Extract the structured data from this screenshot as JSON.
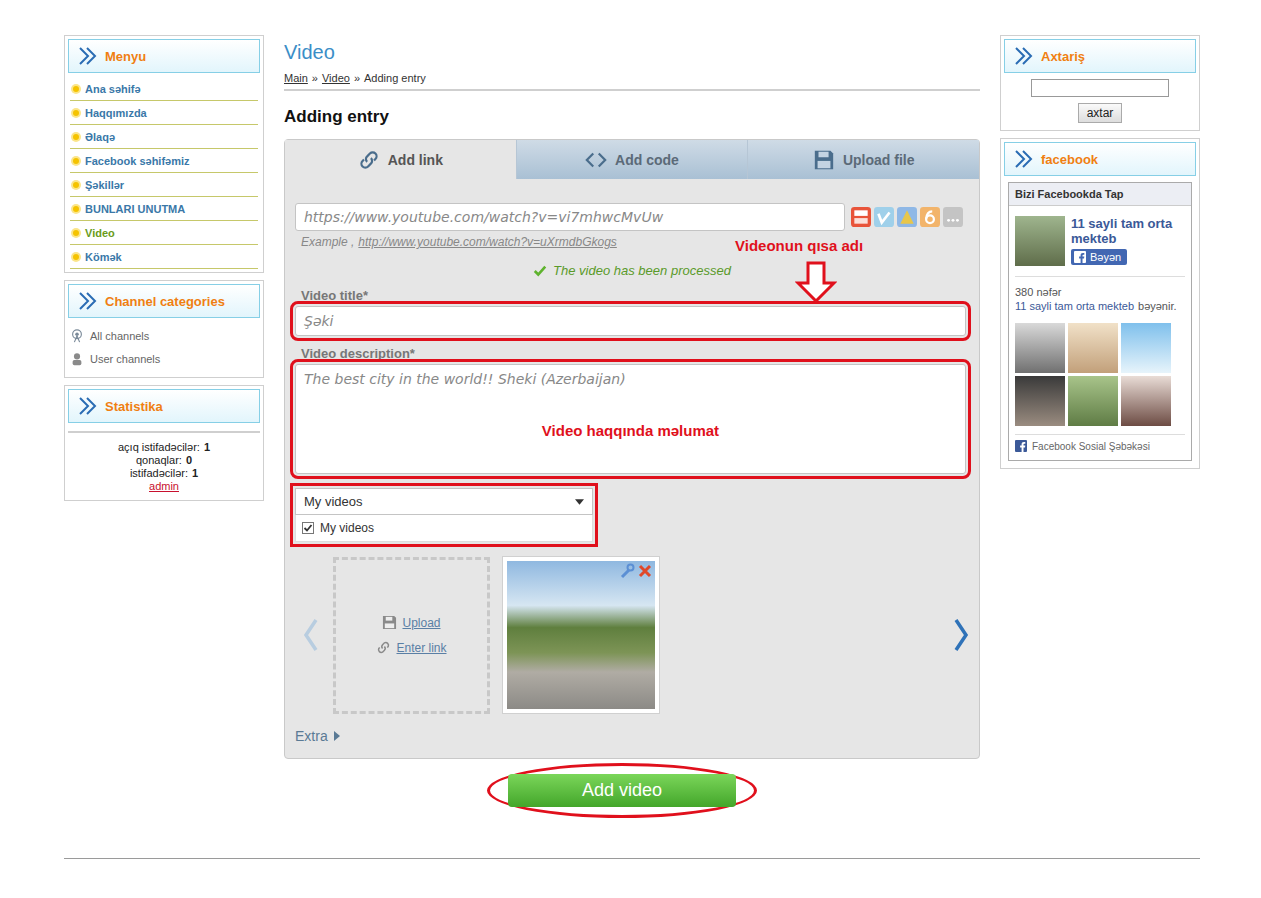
{
  "sidebar": {
    "menu": {
      "title": "Menyu",
      "items": [
        {
          "label": "Ana səhifə",
          "selected": false
        },
        {
          "label": "Haqqımızda",
          "selected": false
        },
        {
          "label": "Əlaqə",
          "selected": false
        },
        {
          "label": "Facebook səhifəmiz",
          "selected": false
        },
        {
          "label": "Şəkillər",
          "selected": false
        },
        {
          "label": "BUNLARI UNUTMA",
          "selected": false
        },
        {
          "label": "Video",
          "selected": true
        },
        {
          "label": "Kömək",
          "selected": false
        }
      ]
    },
    "categories": {
      "title": "Channel categories",
      "items": [
        {
          "label": "All channels",
          "kind": "all"
        },
        {
          "label": "User channels",
          "kind": "user"
        }
      ]
    },
    "stats": {
      "title": "Statistika",
      "lines": [
        {
          "label": "açıq istifadəcilər:",
          "value": "1"
        },
        {
          "label": "qonaqlar:",
          "value": "0"
        },
        {
          "label": "istifadəcilər:",
          "value": "1"
        }
      ],
      "user": "admin"
    }
  },
  "page": {
    "title": "Video",
    "breadcrumb": [
      {
        "label": "Main",
        "link": true
      },
      {
        "label": "Video",
        "link": true
      },
      {
        "label": "Adding entry",
        "link": false
      }
    ],
    "separator": "»",
    "heading": "Adding entry"
  },
  "tabs": [
    {
      "label": "Add link",
      "selected": true
    },
    {
      "label": "Add code",
      "selected": false
    },
    {
      "label": "Upload file",
      "selected": false
    }
  ],
  "form": {
    "url": "https://www.youtube.com/watch?v=vi7mhwcMvUw",
    "example_prefix": "Example ,",
    "example_url": "http://www.youtube.com/watch?v=uXrmdbGkogs",
    "status": "The video has been processed",
    "title_label": "Video title*",
    "title_value": "Şəki",
    "description_label": "Video description*",
    "description_value": "The best city in the world!! Sheki (Azerbaijan)",
    "channel": "My videos",
    "channel_options": [
      {
        "label": "My videos",
        "checked": true
      }
    ],
    "upload": "Upload",
    "enter_link": "Enter link",
    "extra": "Extra",
    "submit": "Add video"
  },
  "annotations": {
    "title_hint": "Videonun qısa adı",
    "description_hint": "Video haqqında məlumat"
  },
  "search": {
    "title": "Axtariş",
    "value": "",
    "button": "axtar"
  },
  "facebook": {
    "title": "facebook",
    "widget_title": "Bizi Facebookda Tap",
    "page_name": "11 sayli tam orta mekteb",
    "like": "Bəyən",
    "likes_prefix": "380 nəfər",
    "likes_link": "11 sayli tam orta mekteb",
    "likes_suffix": "bəyənir.",
    "footer": "Facebook Sosial Şəbəkəsi"
  }
}
